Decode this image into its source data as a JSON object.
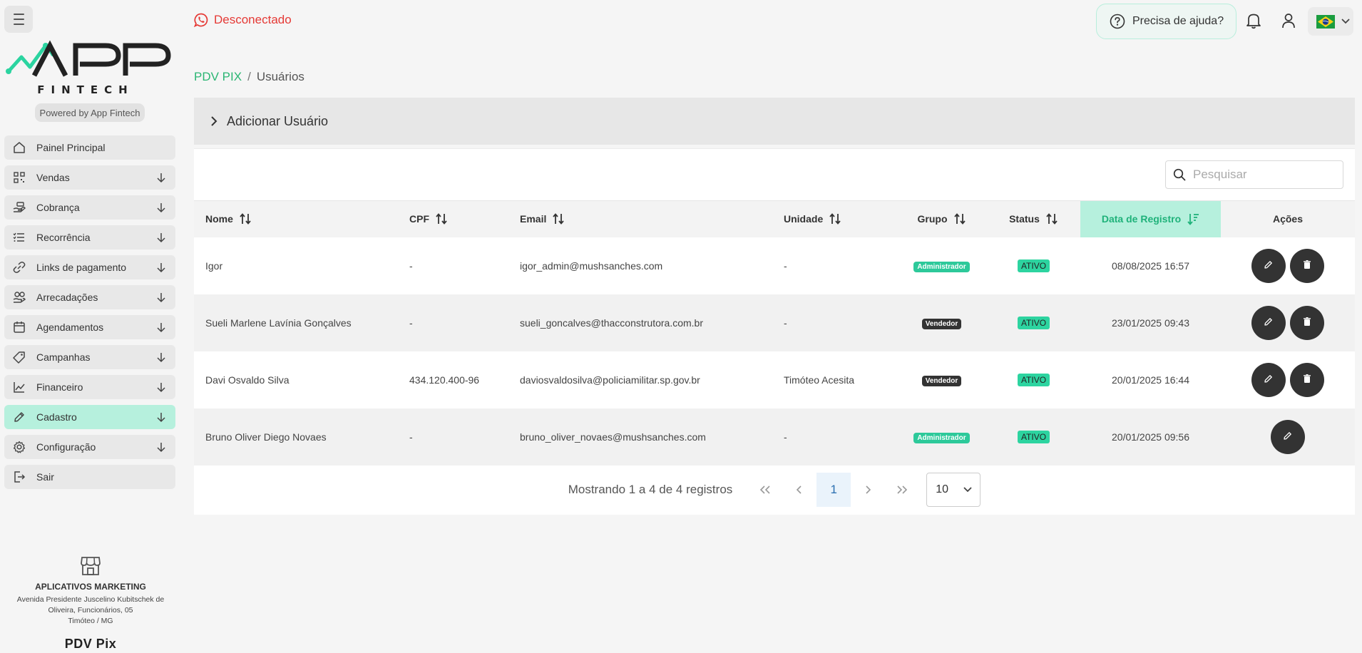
{
  "brand": {
    "logo_text": "APP",
    "logo_sub": "FINTECH",
    "powered": "Powered by App Fintech"
  },
  "nav": [
    {
      "label": "Painel Principal",
      "icon": "home-icon",
      "expand": false
    },
    {
      "label": "Vendas",
      "icon": "qrcode-icon",
      "expand": true
    },
    {
      "label": "Cobrança",
      "icon": "hand-money-icon",
      "expand": true
    },
    {
      "label": "Recorrência",
      "icon": "list-icon",
      "expand": true
    },
    {
      "label": "Links de pagamento",
      "icon": "link-icon",
      "expand": true
    },
    {
      "label": "Arrecadações",
      "icon": "donation-icon",
      "expand": true
    },
    {
      "label": "Agendamentos",
      "icon": "calendar-icon",
      "expand": true
    },
    {
      "label": "Campanhas",
      "icon": "tag-icon",
      "expand": true
    },
    {
      "label": "Financeiro",
      "icon": "chart-icon",
      "expand": true
    },
    {
      "label": "Cadastro",
      "icon": "pencil-icon",
      "expand": true,
      "active": true
    },
    {
      "label": "Configuração",
      "icon": "gear-icon",
      "expand": true
    },
    {
      "label": "Sair",
      "icon": "logout-icon",
      "expand": false
    }
  ],
  "company": {
    "name": "APLICATIVOS MARKETING",
    "address1": "Avenida Presidente Juscelino Kubitschek de",
    "address2": "Oliveira, Funcionários, 05",
    "address3": "Timóteo / MG",
    "product": "PDV Pix"
  },
  "topbar": {
    "whatsapp_status": "Desconectado",
    "help": "Precisa de ajuda?",
    "language_flag": "brazil-flag"
  },
  "breadcrumb": {
    "home": "PDV PIX",
    "sep": "/",
    "current": "Usuários"
  },
  "accordion": {
    "label": "Adicionar Usuário"
  },
  "search": {
    "placeholder": "Pesquisar"
  },
  "table": {
    "headers": {
      "nome": "Nome",
      "cpf": "CPF",
      "email": "Email",
      "unidade": "Unidade",
      "grupo": "Grupo",
      "status": "Status",
      "data": "Data de Registro",
      "acoes": "Ações"
    },
    "rows": [
      {
        "nome": "Igor",
        "cpf": "-",
        "email": "igor_admin@mushsanches.com",
        "unidade": "-",
        "grupo": "Administrador",
        "status": "ATIVO",
        "data": "08/08/2025 16:57"
      },
      {
        "nome": "Sueli Marlene Lavínia Gonçalves",
        "cpf": "-",
        "email": "sueli_goncalves@thacconstrutora.com.br",
        "unidade": "-",
        "grupo": "Vendedor",
        "status": "ATIVO",
        "data": "23/01/2025 09:43"
      },
      {
        "nome": "Davi Osvaldo Silva",
        "cpf": "434.120.400-96",
        "email": "daviosvaldosilva@policiamilitar.sp.gov.br",
        "unidade": "Timóteo Acesita",
        "grupo": "Vendedor",
        "status": "ATIVO",
        "data": "20/01/2025 16:44"
      },
      {
        "nome": "Bruno Oliver Diego Novaes",
        "cpf": "-",
        "email": "bruno_oliver_novaes@mushsanches.com",
        "unidade": "-",
        "grupo": "Administrador",
        "status": "ATIVO",
        "data": "20/01/2025 09:56"
      }
    ]
  },
  "pager": {
    "info": "Mostrando 1 a 4 de 4 registros",
    "first": "«",
    "prev": "‹",
    "page": "1",
    "next": "›",
    "last": "»",
    "page_size": "10"
  },
  "colors": {
    "accent": "#2bb673",
    "highlight": "#b6f0dd",
    "danger": "#e53935"
  }
}
